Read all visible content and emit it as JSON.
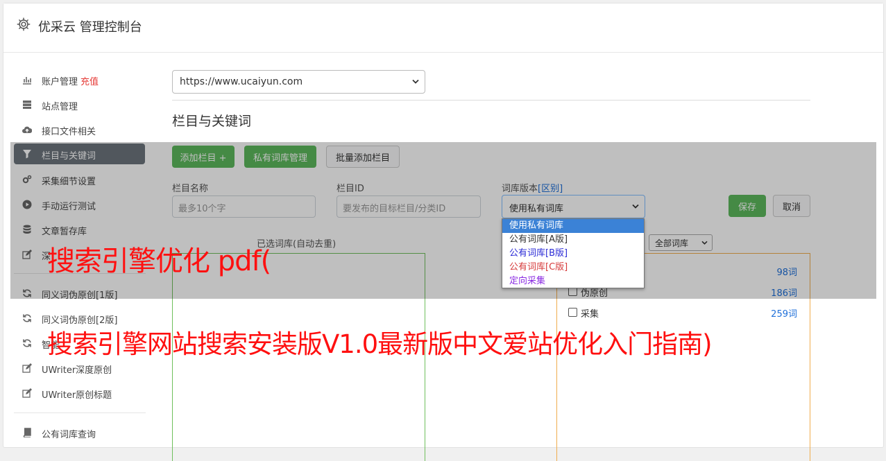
{
  "header": {
    "title": "优采云 管理控制台",
    "icon": "gear-icon"
  },
  "sidebar": {
    "items": [
      {
        "label": "账户管理",
        "extra": "充值",
        "icon": "bar-chart-icon"
      },
      {
        "label": "站点管理",
        "icon": "server-icon"
      },
      {
        "label": "接口文件相关",
        "icon": "cloud-upload-icon"
      },
      {
        "label": "栏目与关键词",
        "icon": "filter-icon",
        "active": true
      },
      {
        "label": "采集细节设置",
        "icon": "cogs-icon"
      },
      {
        "label": "手动运行测试",
        "icon": "play-circle-icon"
      },
      {
        "label": "文章暂存库",
        "icon": "database-icon"
      },
      {
        "label": "深",
        "icon": "edit-icon"
      },
      {
        "label": "同义词伪原创[1版]",
        "icon": "refresh-icon"
      },
      {
        "label": "同义词伪原创[2版]",
        "icon": "refresh-icon"
      },
      {
        "label": "智能",
        "icon": "refresh-icon"
      },
      {
        "label": "UWriter深度原创",
        "icon": "edit-icon"
      },
      {
        "label": "UWriter原创标题",
        "icon": "edit-icon"
      },
      {
        "label": "公有词库查询",
        "icon": "book-icon"
      }
    ]
  },
  "main": {
    "site_select": "https://www.ucaiyun.com",
    "section_title": "栏目与关键词",
    "buttons": {
      "add_column": "添加栏目 +",
      "private_lib": "私有词库管理",
      "batch_add": "批量添加栏目",
      "save": "保存",
      "cancel": "取消"
    },
    "fields": {
      "name_label": "栏目名称",
      "name_placeholder": "最多10个字",
      "id_label": "栏目ID",
      "id_placeholder": "要发布的目标栏目/分类ID",
      "version_label": "词库版本",
      "version_link": "[区别]",
      "version_value": "使用私有词库"
    },
    "left_panel_title": "已选词库(自动去重)",
    "filter_select": "全部词库",
    "libraries": [
      {
        "name": "",
        "count": "98词"
      },
      {
        "name": "伪原创",
        "count": "186词"
      },
      {
        "name": "采集",
        "count": "259词"
      }
    ],
    "dropdown_options": [
      {
        "label": "使用私有词库",
        "color": "#ffffff"
      },
      {
        "label": "公有词库[A版]",
        "color": "#333333"
      },
      {
        "label": "公有词库[B版]",
        "color": "#2b2bd6"
      },
      {
        "label": "公有词库[C版]",
        "color": "#d63b3b"
      },
      {
        "label": "定向采集",
        "color": "#8a2be2"
      }
    ]
  },
  "watermarks": {
    "line1": "搜索引擎优化 pdf(",
    "line2": "搜索引擎网站搜索安装版V1.0最新版中文爱站优化入门指南)"
  }
}
